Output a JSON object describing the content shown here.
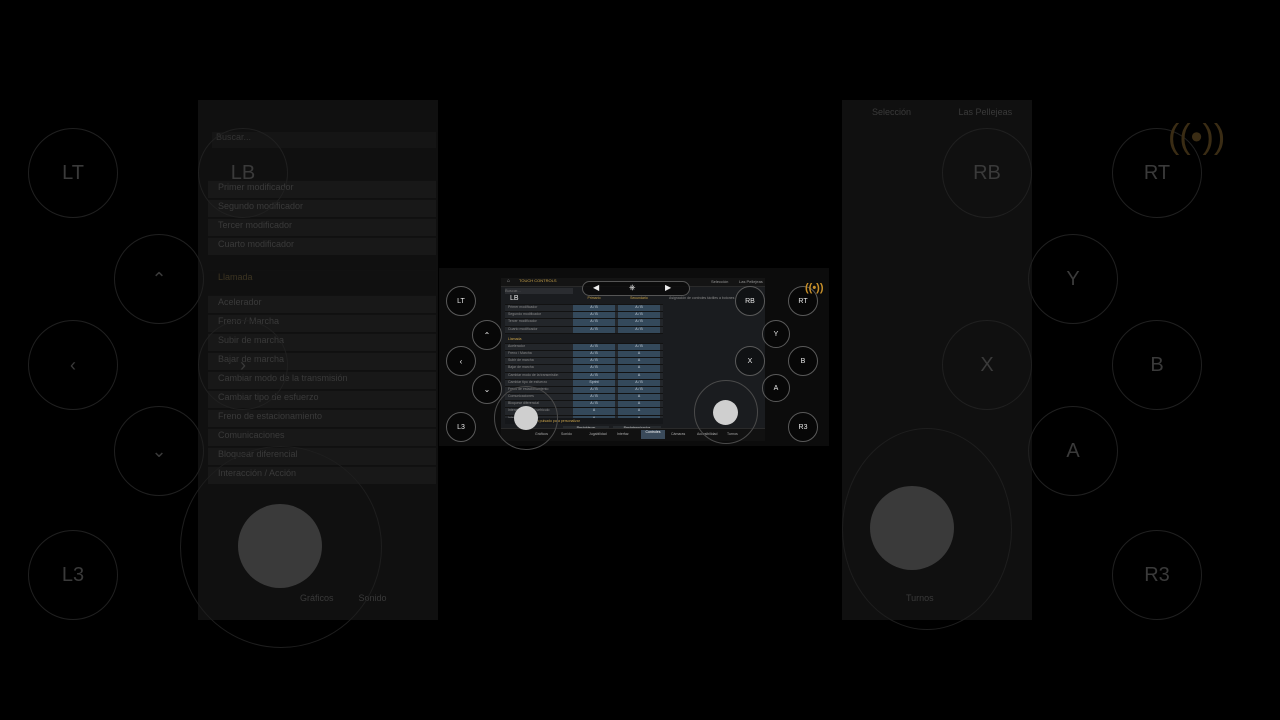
{
  "app": {
    "breadcrumb": "TOUCH CONTROLS",
    "search_placeholder": "Buscar...",
    "tabs_right": [
      "Selección",
      "Las Pellejeas"
    ],
    "right_hint": "Asignación de controles táctiles a botones"
  },
  "table": {
    "headers": [
      "",
      "Primario",
      "Secundario"
    ],
    "rows": [
      {
        "label": "Primer modificador",
        "c1": "A / B",
        "c2": "A / B"
      },
      {
        "label": "Segundo modificador",
        "c1": "A / B",
        "c2": "A / B"
      },
      {
        "label": "Tercer modificador",
        "c1": "A / B",
        "c2": "A / B"
      },
      {
        "label": "Cuarto modificador",
        "c1": "A / B",
        "c2": "A / B"
      }
    ],
    "section": "Llamada",
    "rows2": [
      {
        "label": "Acelerador",
        "c1": "A / B",
        "c2": "A / B"
      },
      {
        "label": "Freno / Marcha",
        "c1": "A / B",
        "c2": "A"
      },
      {
        "label": "Subir de marcha",
        "c1": "A / B",
        "c2": "A"
      },
      {
        "label": "Bajar de marcha",
        "c1": "A / B",
        "c2": "A"
      },
      {
        "label": "Cambiar modo de la transmisión",
        "c1": "A / B",
        "c2": "A"
      },
      {
        "label": "Cambiar tipo de esfuerzo",
        "c1": "Sprint",
        "c2": "A / B"
      },
      {
        "label": "Freno de estacionamiento",
        "c1": "A / B",
        "c2": "A / B"
      },
      {
        "label": "Comunicaciones",
        "c1": "A / B",
        "c2": "A"
      },
      {
        "label": "Bloquear diferencial",
        "c1": "A / B",
        "c2": "A"
      },
      {
        "label": "Interacción con el vehículo",
        "c1": "A",
        "c2": "A"
      },
      {
        "label": "Interacción / Acción",
        "c1": "A",
        "c2": "A"
      }
    ]
  },
  "hintbar": {
    "left": "Mantén pulsado para personalizar",
    "b1": "Restablecer",
    "b2": "Predeterminados"
  },
  "footer": [
    "Gráficos",
    "Sonido",
    "Jugabilidad",
    "Interfaz",
    "Controles",
    "Cámaras",
    "Accesibilidad",
    "Turnos"
  ],
  "background_left": {
    "items": [
      "Buscar...",
      "Primer modificador",
      "Segundo modificador",
      "Tercer modificador",
      "Cuarto modificador",
      "Llamada",
      "Acelerador",
      "Freno / Marcha",
      "Subir de marcha",
      "Bajar de marcha",
      "Cambiar modo de la transmisión",
      "Cambiar tipo de esfuerzo",
      "Freno de estacionamiento",
      "Comunicaciones",
      "Bloquear diferencial",
      "Interacción / Acción"
    ],
    "footer": [
      "Gráficos",
      "Sonido"
    ]
  },
  "background_right": {
    "tabs": [
      "Selección",
      "Las Pellejeas"
    ],
    "footer": "Turnos"
  },
  "controls": {
    "LT": "LT",
    "LB": "LB",
    "RB": "RB",
    "RT": "RT",
    "L3": "L3",
    "R3": "R3",
    "X": "X",
    "Y": "Y",
    "A": "A",
    "B": "B",
    "up": "⌃",
    "down": "⌄",
    "left": "‹",
    "right": "›",
    "top_prev": "◀",
    "top_next": "▶"
  },
  "colors": {
    "accent": "#c8a24a",
    "cast": "#c8902a",
    "cell": "#34495b"
  },
  "icons": [
    "home-icon",
    "gamepad-icon",
    "cast-icon",
    "settings-icon"
  ]
}
